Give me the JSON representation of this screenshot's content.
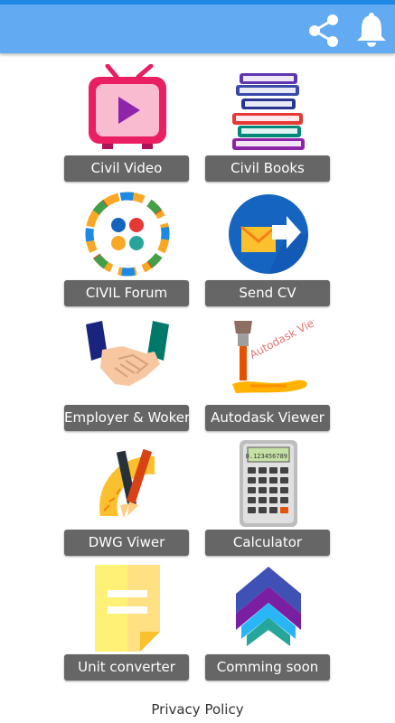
{
  "appbar": {
    "color": "#62abf2",
    "actions": [
      {
        "icon": "share-icon"
      },
      {
        "icon": "bell-icon"
      }
    ]
  },
  "tiles": [
    {
      "label": "Civil Video",
      "icon": "tv-play-icon"
    },
    {
      "label": "Civil Books",
      "icon": "books-stack-icon"
    },
    {
      "label": "CIVIL Forum",
      "icon": "forum-circle-icon"
    },
    {
      "label": "Send CV",
      "icon": "send-envelope-icon"
    },
    {
      "label": "Employer & Woker",
      "icon": "handshake-icon"
    },
    {
      "label": "Autodask Viewer",
      "icon": "paintbrush-icon",
      "icon_text": "Autodask View"
    },
    {
      "label": "DWG Viwer",
      "icon": "drafting-tools-icon"
    },
    {
      "label": "Calculator",
      "icon": "calculator-icon",
      "icon_text": "0.123456789"
    },
    {
      "label": "Unit converter",
      "icon": "sticky-note-icon"
    },
    {
      "label": "Comming soon",
      "icon": "house-chevrons-icon"
    }
  ],
  "footer": {
    "privacy_label": "Privacy Policy"
  }
}
